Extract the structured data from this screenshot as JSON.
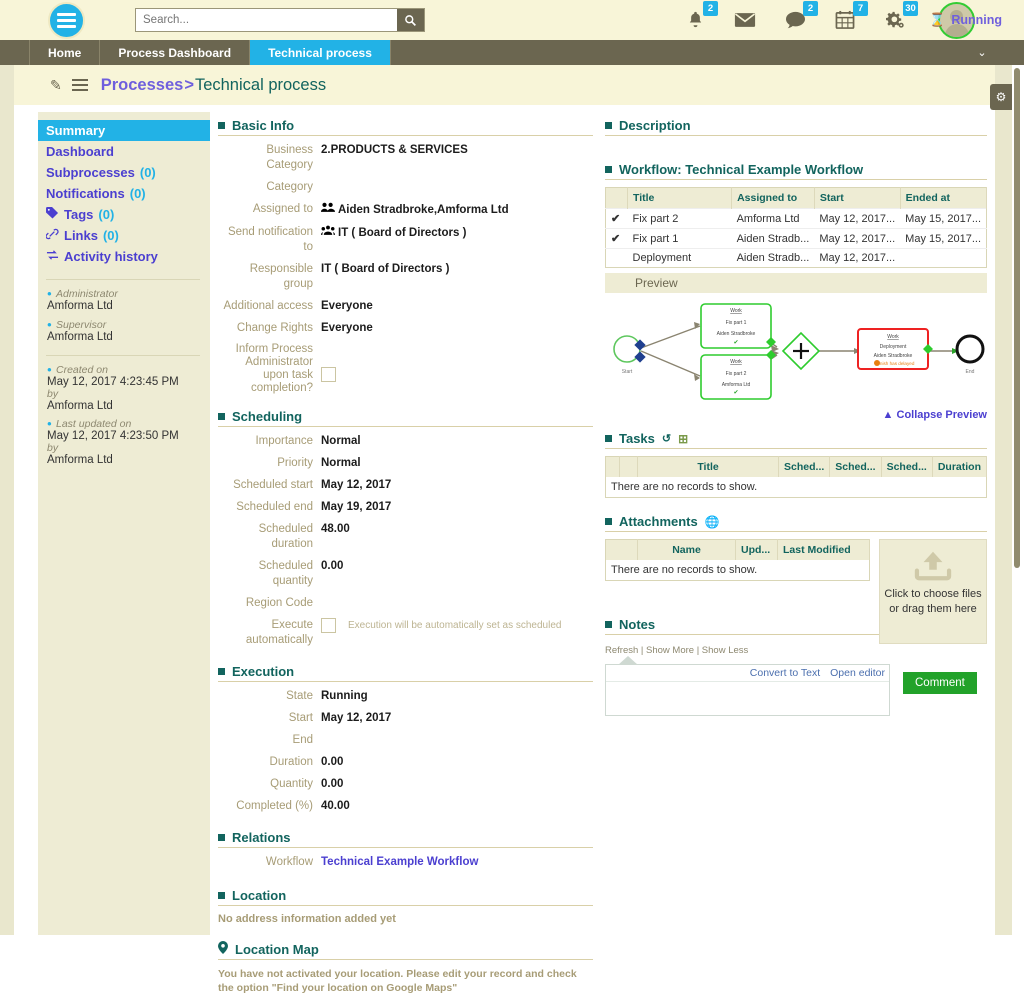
{
  "topbar": {
    "logo_name": "app-logo",
    "search": {
      "value": "",
      "placeholder": "Search..."
    },
    "icons": [
      {
        "name": "bell-icon",
        "badge": "2"
      },
      {
        "name": "mail-icon",
        "badge": ""
      },
      {
        "name": "chat-icon",
        "badge": "2"
      },
      {
        "name": "calendar-icon",
        "badge": "7"
      },
      {
        "name": "gear-icon",
        "badge": "30"
      }
    ]
  },
  "nav": {
    "items": [
      {
        "label": "Home",
        "active": false
      },
      {
        "label": "Process Dashboard",
        "active": false
      },
      {
        "label": "Technical process",
        "active": true
      }
    ],
    "caret": "⌄"
  },
  "title": {
    "breadcrumb_link": "Processes",
    "breadcrumb_sep": " >",
    "breadcrumb_current": "Technical process",
    "status": "Running"
  },
  "sidebar": {
    "items": [
      {
        "label": "Summary",
        "count": "",
        "active": true,
        "icon": ""
      },
      {
        "label": "Dashboard",
        "count": "",
        "active": false,
        "icon": ""
      },
      {
        "label": "Subprocesses",
        "count": "(0)",
        "active": false,
        "icon": ""
      },
      {
        "label": "Notifications",
        "count": "(0)",
        "active": false,
        "icon": ""
      },
      {
        "label": "Tags",
        "count": "(0)",
        "active": false,
        "icon": "tag-icon"
      },
      {
        "label": "Links",
        "count": "(0)",
        "active": false,
        "icon": "link-icon"
      },
      {
        "label": "Activity history",
        "count": "",
        "active": false,
        "icon": "history-icon"
      }
    ],
    "meta": [
      {
        "label": "Administrator",
        "value": "Amforma Ltd",
        "by": ""
      },
      {
        "label": "Supervisor",
        "value": "Amforma Ltd",
        "by": ""
      }
    ],
    "meta2": [
      {
        "label": "Created on",
        "value": "May 12, 2017 4:23:45 PM",
        "by": "by",
        "by_value": "Amforma Ltd"
      },
      {
        "label": "Last updated on",
        "value": "May 12, 2017 4:23:50 PM",
        "by": "by",
        "by_value": "Amforma Ltd"
      }
    ]
  },
  "basic_info": {
    "title": "Basic Info",
    "fields": [
      {
        "label": "Business Category",
        "value": "2.PRODUCTS & SERVICES",
        "icon": ""
      },
      {
        "label": "Category",
        "value": "",
        "icon": ""
      },
      {
        "label": "Assigned to",
        "value": "Aiden Stradbroke,Amforma Ltd",
        "icon": "users-icon"
      },
      {
        "label": "Send notification to",
        "value": "IT ( Board of Directors )",
        "icon": "group-icon"
      },
      {
        "label": "Responsible group",
        "value": "IT ( Board of Directors )",
        "icon": ""
      },
      {
        "label": "Additional access",
        "value": "Everyone",
        "icon": ""
      },
      {
        "label": "Change Rights",
        "value": "Everyone",
        "icon": ""
      }
    ],
    "checkbox_label": "Inform Process Administrator upon task completion?",
    "checkbox_checked": false
  },
  "scheduling": {
    "title": "Scheduling",
    "fields": [
      {
        "label": "Importance",
        "value": "Normal"
      },
      {
        "label": "Priority",
        "value": "Normal"
      },
      {
        "label": "Scheduled start",
        "value": "May 12, 2017"
      },
      {
        "label": "Scheduled end",
        "value": "May 19, 2017"
      },
      {
        "label": "Scheduled duration",
        "value": "48.00"
      },
      {
        "label": "Scheduled quantity",
        "value": "0.00"
      },
      {
        "label": "Region Code",
        "value": ""
      }
    ],
    "auto_label": "Execute automatically",
    "auto_hint": "Execution will be automatically set as scheduled",
    "auto_checked": false
  },
  "execution": {
    "title": "Execution",
    "fields": [
      {
        "label": "State",
        "value": "Running"
      },
      {
        "label": "Start",
        "value": "May 12, 2017"
      },
      {
        "label": "End",
        "value": ""
      },
      {
        "label": "Duration",
        "value": "0.00"
      },
      {
        "label": "Quantity",
        "value": "0.00"
      },
      {
        "label": "Completed (%)",
        "value": "40.00"
      }
    ]
  },
  "relations": {
    "title": "Relations",
    "label": "Workflow",
    "value": "Technical Example Workflow"
  },
  "location": {
    "title": "Location",
    "empty": "No address information added yet",
    "map_title": "Location Map",
    "map_empty": "You have not activated your location. Please edit your record and check the option \"Find your location on Google Maps\""
  },
  "description": {
    "title": "Description"
  },
  "workflow": {
    "title": "Workflow: Technical Example Workflow",
    "columns": [
      "",
      "Title",
      "Assigned to",
      "Start",
      "Ended at"
    ],
    "rows": [
      {
        "check": "✔",
        "title": "Fix part 2",
        "assigned": "Amforma Ltd",
        "start": "May 12, 2017...",
        "ended": "May 15, 2017..."
      },
      {
        "check": "✔",
        "title": "Fix part 1",
        "assigned": "Aiden Stradb...",
        "start": "May 12, 2017...",
        "ended": "May 15, 2017..."
      },
      {
        "check": "",
        "title": "Deployment",
        "assigned": "Aiden Stradb...",
        "start": "May 12, 2017...",
        "ended": ""
      }
    ],
    "preview_label": "Preview",
    "collapse_label": "Collapse Preview",
    "diagram": {
      "start_label": "Start",
      "end_label": "End",
      "nodes": [
        {
          "type": "Work",
          "title": "Fix part 1",
          "assignee": "Aiden Stradbroke",
          "state": "done"
        },
        {
          "type": "Work",
          "title": "Fix part 2",
          "assignee": "Amforma Ltd",
          "state": "done"
        },
        {
          "type": "Work",
          "title": "Deployment",
          "assignee": "Aiden Stradbroke",
          "state": "delayed",
          "warning": "finish has delayed"
        }
      ],
      "gateway": "+"
    }
  },
  "tasks": {
    "title": "Tasks",
    "columns": [
      "",
      "",
      "Title",
      "Sched...",
      "Sched...",
      "Sched...",
      "Duration"
    ],
    "empty": "There are no records to show."
  },
  "attachments": {
    "title": "Attachments",
    "columns": [
      "",
      "Name",
      "Upd...",
      "Last Modified"
    ],
    "empty": "There are no records to show.",
    "dropzone": "Click to choose files or drag them here"
  },
  "notes": {
    "title": "Notes",
    "links": "Refresh | Show More | Show Less",
    "convert": "Convert to Text",
    "editor": "Open editor",
    "value": "",
    "button": "Comment"
  },
  "colors": {
    "accent": "#22b2e6",
    "nav": "#6b6650",
    "cream": "#f8f5d8",
    "teal": "#12645e",
    "purple": "#4b3fd0",
    "green": "#22a22a",
    "red": "#ee2222"
  }
}
